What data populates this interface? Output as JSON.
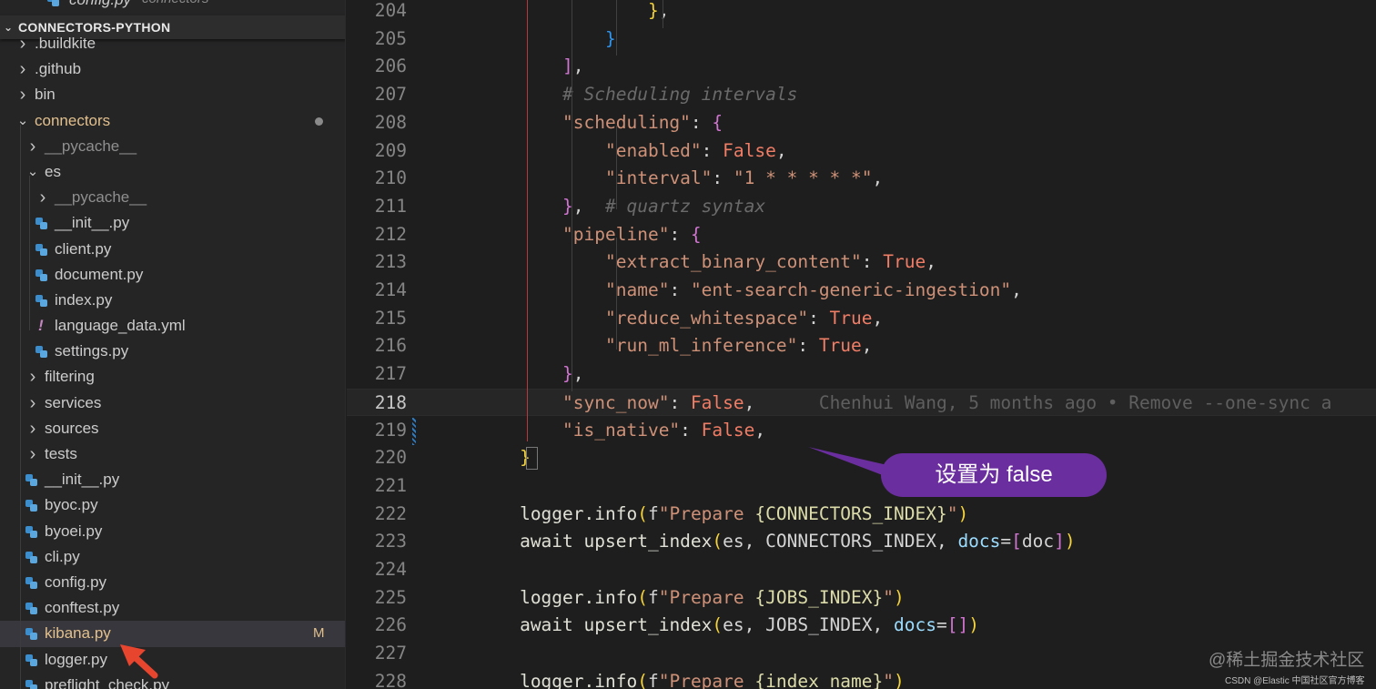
{
  "explorer": {
    "partial_top_file": {
      "name": "config.py",
      "description": "connectors",
      "icon": "python-file-icon"
    },
    "root_label": "CONNECTORS-PYTHON",
    "items": [
      {
        "id": "buildkite",
        "label": ".buildkite",
        "type": "folder",
        "expanded": false,
        "depth": 0
      },
      {
        "id": "github",
        "label": ".github",
        "type": "folder",
        "expanded": false,
        "depth": 0
      },
      {
        "id": "bin",
        "label": "bin",
        "type": "folder",
        "expanded": false,
        "depth": 0
      },
      {
        "id": "connectors",
        "label": "connectors",
        "type": "folder",
        "expanded": true,
        "depth": 0,
        "modified": true
      },
      {
        "id": "pycache1",
        "label": "__pycache__",
        "type": "folder",
        "expanded": false,
        "depth": 1,
        "dim": true
      },
      {
        "id": "es",
        "label": "es",
        "type": "folder",
        "expanded": true,
        "depth": 1
      },
      {
        "id": "pycache2",
        "label": "__pycache__",
        "type": "folder",
        "expanded": false,
        "depth": 2,
        "dim": true
      },
      {
        "id": "es-init",
        "label": "__init__.py",
        "type": "py",
        "depth": 2
      },
      {
        "id": "client",
        "label": "client.py",
        "type": "py",
        "depth": 2
      },
      {
        "id": "document",
        "label": "document.py",
        "type": "py",
        "depth": 2
      },
      {
        "id": "index",
        "label": "index.py",
        "type": "py",
        "depth": 2
      },
      {
        "id": "language-data",
        "label": "language_data.yml",
        "type": "yml",
        "depth": 2
      },
      {
        "id": "settings",
        "label": "settings.py",
        "type": "py",
        "depth": 2
      },
      {
        "id": "filtering",
        "label": "filtering",
        "type": "folder",
        "expanded": false,
        "depth": 1
      },
      {
        "id": "services",
        "label": "services",
        "type": "folder",
        "expanded": false,
        "depth": 1
      },
      {
        "id": "sources",
        "label": "sources",
        "type": "folder",
        "expanded": false,
        "depth": 1
      },
      {
        "id": "tests",
        "label": "tests",
        "type": "folder",
        "expanded": false,
        "depth": 1
      },
      {
        "id": "init",
        "label": "__init__.py",
        "type": "py",
        "depth": 1
      },
      {
        "id": "byoc",
        "label": "byoc.py",
        "type": "py",
        "depth": 1
      },
      {
        "id": "byoei",
        "label": "byoei.py",
        "type": "py",
        "depth": 1
      },
      {
        "id": "cli",
        "label": "cli.py",
        "type": "py",
        "depth": 1
      },
      {
        "id": "config",
        "label": "config.py",
        "type": "py",
        "depth": 1
      },
      {
        "id": "conftest",
        "label": "conftest.py",
        "type": "py",
        "depth": 1
      },
      {
        "id": "kibana",
        "label": "kibana.py",
        "type": "py",
        "depth": 1,
        "selected": true,
        "badge": "M"
      },
      {
        "id": "logger",
        "label": "logger.py",
        "type": "py",
        "depth": 1
      },
      {
        "id": "preflight",
        "label": "preflight_check.py",
        "type": "py",
        "depth": 1
      }
    ]
  },
  "editor": {
    "current_line": 218,
    "blame": "Chenhui Wang, 5 months ago • Remove --one-sync a",
    "lines": [
      {
        "n": 204,
        "tokens": [
          [
            "p",
            "                        "
          ],
          [
            "f1",
            "}"
          ],
          [
            "p",
            ","
          ]
        ]
      },
      {
        "n": 205,
        "tokens": [
          [
            "p",
            "                    "
          ],
          [
            "f3",
            "}"
          ]
        ]
      },
      {
        "n": 206,
        "tokens": [
          [
            "p",
            "                "
          ],
          [
            "f2",
            "]"
          ],
          [
            "p",
            ","
          ]
        ]
      },
      {
        "n": 207,
        "tokens": [
          [
            "p",
            "                "
          ],
          [
            "c",
            "# Scheduling intervals"
          ]
        ]
      },
      {
        "n": 208,
        "tokens": [
          [
            "p",
            "                "
          ],
          [
            "s",
            "\"scheduling\""
          ],
          [
            "p",
            ": "
          ],
          [
            "f2",
            "{"
          ]
        ]
      },
      {
        "n": 209,
        "tokens": [
          [
            "p",
            "                    "
          ],
          [
            "s",
            "\"enabled\""
          ],
          [
            "p",
            ": "
          ],
          [
            "kw",
            "False"
          ],
          [
            "p",
            ","
          ]
        ]
      },
      {
        "n": 210,
        "tokens": [
          [
            "p",
            "                    "
          ],
          [
            "s",
            "\"interval\""
          ],
          [
            "p",
            ": "
          ],
          [
            "s",
            "\"1 * * * * *\""
          ],
          [
            "p",
            ","
          ]
        ]
      },
      {
        "n": 211,
        "tokens": [
          [
            "p",
            "                "
          ],
          [
            "f2",
            "}"
          ],
          [
            "p",
            ",  "
          ],
          [
            "c",
            "# quartz syntax"
          ]
        ]
      },
      {
        "n": 212,
        "tokens": [
          [
            "p",
            "                "
          ],
          [
            "s",
            "\"pipeline\""
          ],
          [
            "p",
            ": "
          ],
          [
            "f2",
            "{"
          ]
        ]
      },
      {
        "n": 213,
        "tokens": [
          [
            "p",
            "                    "
          ],
          [
            "s",
            "\"extract_binary_content\""
          ],
          [
            "p",
            ": "
          ],
          [
            "kw",
            "True"
          ],
          [
            "p",
            ","
          ]
        ]
      },
      {
        "n": 214,
        "tokens": [
          [
            "p",
            "                    "
          ],
          [
            "s",
            "\"name\""
          ],
          [
            "p",
            ": "
          ],
          [
            "s",
            "\"ent-search-generic-ingestion\""
          ],
          [
            "p",
            ","
          ]
        ]
      },
      {
        "n": 215,
        "tokens": [
          [
            "p",
            "                    "
          ],
          [
            "s",
            "\"reduce_whitespace\""
          ],
          [
            "p",
            ": "
          ],
          [
            "kw",
            "True"
          ],
          [
            "p",
            ","
          ]
        ]
      },
      {
        "n": 216,
        "tokens": [
          [
            "p",
            "                    "
          ],
          [
            "s",
            "\"run_ml_inference\""
          ],
          [
            "p",
            ": "
          ],
          [
            "kw",
            "True"
          ],
          [
            "p",
            ","
          ]
        ]
      },
      {
        "n": 217,
        "tokens": [
          [
            "p",
            "                "
          ],
          [
            "f2",
            "}"
          ],
          [
            "p",
            ","
          ]
        ]
      },
      {
        "n": 218,
        "tokens": [
          [
            "p",
            "                "
          ],
          [
            "s",
            "\"sync_now\""
          ],
          [
            "p",
            ": "
          ],
          [
            "kw",
            "False"
          ],
          [
            "p",
            ","
          ]
        ]
      },
      {
        "n": 219,
        "tokens": [
          [
            "p",
            "                "
          ],
          [
            "s",
            "\"is_native\""
          ],
          [
            "p",
            ": "
          ],
          [
            "kw",
            "False"
          ],
          [
            "p",
            ","
          ]
        ]
      },
      {
        "n": 220,
        "tokens": [
          [
            "p",
            "            "
          ],
          [
            "f1",
            "}"
          ]
        ]
      },
      {
        "n": 221,
        "tokens": []
      },
      {
        "n": 222,
        "tokens": [
          [
            "p",
            "            "
          ],
          [
            "k",
            "logger.info"
          ],
          [
            "f1",
            "("
          ],
          [
            "p",
            "f"
          ],
          [
            "s",
            "\"Prepare "
          ],
          [
            "fn",
            "{CONNECTORS_INDEX}"
          ],
          [
            "s",
            "\""
          ],
          [
            "f1",
            ")"
          ]
        ]
      },
      {
        "n": 223,
        "tokens": [
          [
            "p",
            "            "
          ],
          [
            "k",
            "await upsert_index"
          ],
          [
            "f1",
            "("
          ],
          [
            "p",
            "es, CONNECTORS_INDEX, "
          ],
          [
            "var",
            "docs"
          ],
          [
            "p",
            "="
          ],
          [
            "f2",
            "["
          ],
          [
            "p",
            "doc"
          ],
          [
            "f2",
            "]"
          ],
          [
            "f1",
            ")"
          ]
        ]
      },
      {
        "n": 224,
        "tokens": []
      },
      {
        "n": 225,
        "tokens": [
          [
            "p",
            "            "
          ],
          [
            "k",
            "logger.info"
          ],
          [
            "f1",
            "("
          ],
          [
            "p",
            "f"
          ],
          [
            "s",
            "\"Prepare "
          ],
          [
            "fn",
            "{JOBS_INDEX}"
          ],
          [
            "s",
            "\""
          ],
          [
            "f1",
            ")"
          ]
        ]
      },
      {
        "n": 226,
        "tokens": [
          [
            "p",
            "            "
          ],
          [
            "k",
            "await upsert_index"
          ],
          [
            "f1",
            "("
          ],
          [
            "p",
            "es, JOBS_INDEX, "
          ],
          [
            "var",
            "docs"
          ],
          [
            "p",
            "="
          ],
          [
            "f2",
            "[]"
          ],
          [
            "f1",
            ")"
          ]
        ]
      },
      {
        "n": 227,
        "tokens": []
      },
      {
        "n": 228,
        "tokens": [
          [
            "p",
            "            "
          ],
          [
            "k",
            "logger.info"
          ],
          [
            "f1",
            "("
          ],
          [
            "p",
            "f"
          ],
          [
            "s",
            "\"Prepare "
          ],
          [
            "fn",
            "{index_name}"
          ],
          [
            "s",
            "\""
          ],
          [
            "f1",
            ")"
          ]
        ]
      }
    ]
  },
  "annotation": {
    "text": "设置为 false",
    "color": "#6a2e9e"
  },
  "watermarks": {
    "juejin": "@稀土掘金技术社区",
    "csdn": "CSDN @Elastic 中国社区官方博客"
  },
  "colors": {
    "accent_arrow": "#e8452f",
    "modified": "#e2c08d"
  }
}
